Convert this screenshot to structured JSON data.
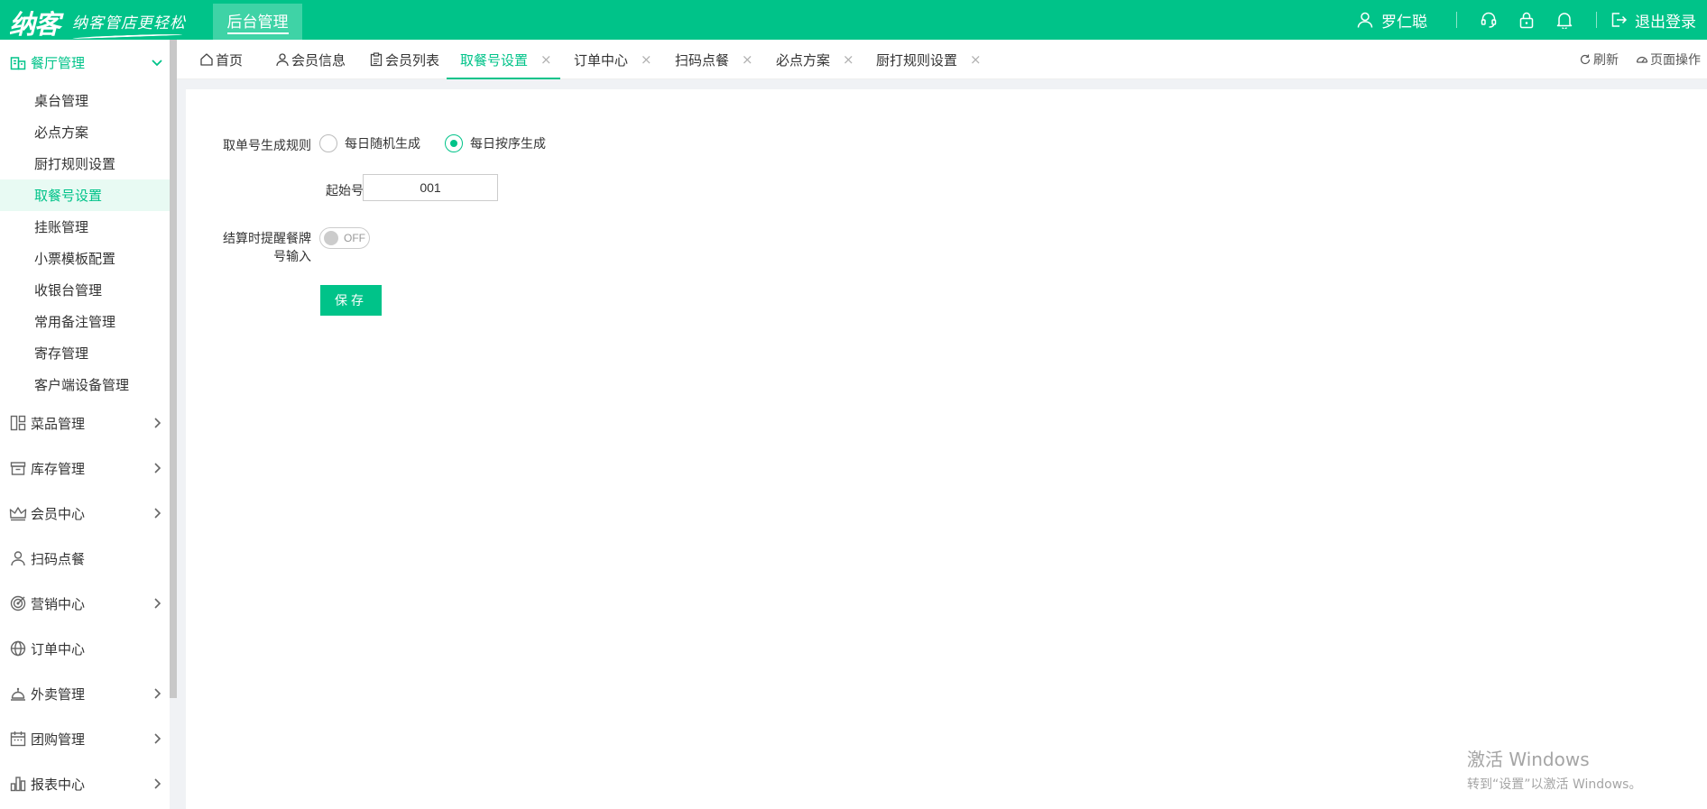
{
  "header": {
    "logo_main": "纳客",
    "logo_sub": "纳客管店更轻松",
    "system_tab": "后台管理",
    "user_name": "罗仁聪",
    "logout_label": "退出登录",
    "icons": [
      "user-icon",
      "headset-icon",
      "lock-icon",
      "bell-icon",
      "logout-icon"
    ],
    "colors": {
      "brand": "#00c389",
      "brand_light": "#3fd3a6"
    }
  },
  "sidebar": {
    "groups": [
      {
        "label": "餐厅管理",
        "icon": "restaurant-icon",
        "expanded": true,
        "items": [
          "桌台管理",
          "必点方案",
          "厨打规则设置",
          "取餐号设置",
          "挂账管理",
          "小票模板配置",
          "收银台管理",
          "常用备注管理",
          "寄存管理",
          "客户端设备管理"
        ],
        "active_item": "取餐号设置"
      },
      {
        "label": "菜品管理",
        "icon": "dishes-icon"
      },
      {
        "label": "库存管理",
        "icon": "inventory-icon"
      },
      {
        "label": "会员中心",
        "icon": "crown-icon"
      },
      {
        "label": "扫码点餐",
        "icon": "person-icon"
      },
      {
        "label": "营销中心",
        "icon": "target-icon"
      },
      {
        "label": "订单中心",
        "icon": "globe-icon"
      },
      {
        "label": "外卖管理",
        "icon": "service-bell-icon"
      },
      {
        "label": "团购管理",
        "icon": "calendar-icon"
      },
      {
        "label": "报表中心",
        "icon": "bar-chart-icon"
      }
    ]
  },
  "tabs": [
    {
      "label": "首页",
      "icon": "home-icon",
      "closable": false
    },
    {
      "label": "会员信息",
      "icon": "user-icon",
      "closable": false
    },
    {
      "label": "会员列表",
      "icon": "clipboard-icon",
      "closable": false
    },
    {
      "label": "取餐号设置",
      "closable": true,
      "active": true
    },
    {
      "label": "订单中心",
      "closable": true
    },
    {
      "label": "扫码点餐",
      "closable": true
    },
    {
      "label": "必点方案",
      "closable": true
    },
    {
      "label": "厨打规则设置",
      "closable": true
    }
  ],
  "tab_tools": {
    "refresh": "刷新",
    "page_ops": "页面操作",
    "close_glyph": "×"
  },
  "form": {
    "rule_label": "取单号生成规则",
    "options": [
      "每日随机生成",
      "每日按序生成"
    ],
    "selected_option": "每日按序生成",
    "start_label": "起始号",
    "start_value": "001",
    "remind_label_line1": "结算时提醒餐牌",
    "remind_label_line2": "号输入",
    "remind_state": "OFF",
    "save_label": "保存"
  },
  "watermark": {
    "line1": "激活 Windows",
    "line2": "转到“设置”以激活 Windows。"
  }
}
